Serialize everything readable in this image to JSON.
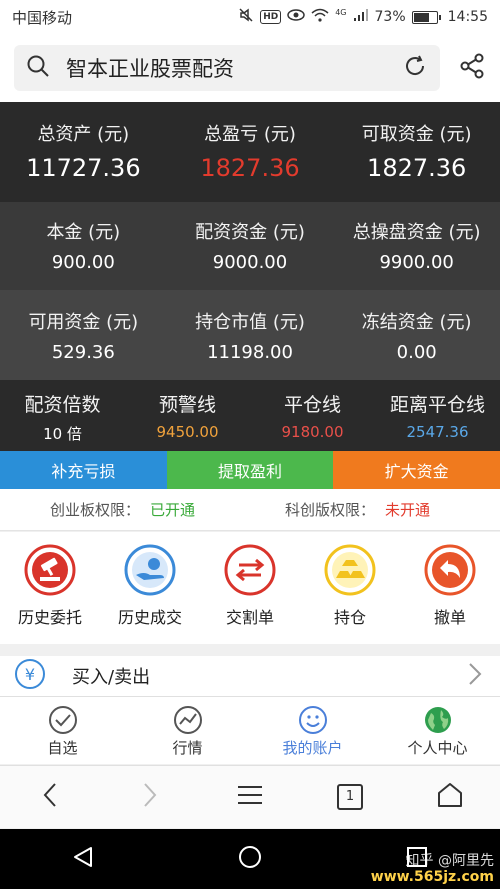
{
  "status_bar": {
    "carrier": "中国移动",
    "hd": "HD",
    "network": "4G",
    "battery": "73%",
    "battery_level": 0.73,
    "time": "14:55"
  },
  "search": {
    "title": "智本正业股票配资",
    "icons": [
      "search-icon",
      "refresh-icon",
      "share-icon"
    ]
  },
  "account": {
    "row1": [
      {
        "label": "总资产 (元)",
        "value": "11727.36",
        "color": "#ffffff"
      },
      {
        "label": "总盈亏 (元)",
        "value": "1827.36",
        "color": "#e23b2d"
      },
      {
        "label": "可取资金 (元)",
        "value": "1827.36",
        "color": "#ffffff"
      }
    ],
    "row2": [
      {
        "label": "本金 (元)",
        "value": "900.00"
      },
      {
        "label": "配资资金 (元)",
        "value": "9000.00"
      },
      {
        "label": "总操盘资金 (元)",
        "value": "9900.00"
      }
    ],
    "row3": [
      {
        "label": "可用资金 (元)",
        "value": "529.36"
      },
      {
        "label": "持仓市值 (元)",
        "value": "11198.00"
      },
      {
        "label": "冻结资金 (元)",
        "value": "0.00"
      }
    ],
    "row4": [
      {
        "label": "配资倍数",
        "value": "10 倍",
        "color": "#ffffff"
      },
      {
        "label": "预警线",
        "value": "9450.00",
        "color": "#f0a23c"
      },
      {
        "label": "平仓线",
        "value": "9180.00",
        "color": "#e8504a"
      },
      {
        "label": "距离平仓线",
        "value": "2547.36",
        "color": "#5aa8e8"
      }
    ]
  },
  "actions": [
    {
      "label": "补充亏损",
      "color": "#2a8fd8"
    },
    {
      "label": "提取盈利",
      "color": "#4cb84c"
    },
    {
      "label": "扩大资金",
      "color": "#f07a1e"
    }
  ],
  "permissions": {
    "gem_label": "创业板权限：",
    "gem_status": "已开通",
    "star_label": "科创版权限：",
    "star_status": "未开通"
  },
  "quick_menu": [
    {
      "label": "历史委托",
      "icon": "gavel-icon",
      "color": "#d9342b"
    },
    {
      "label": "历史成交",
      "icon": "hand-coin-icon",
      "color": "#3b8ad8"
    },
    {
      "label": "交割单",
      "icon": "exchange-arrows-icon",
      "color": "#d9342b"
    },
    {
      "label": "持仓",
      "icon": "gold-bars-icon",
      "color": "#f2c21e"
    },
    {
      "label": "撤单",
      "icon": "undo-arrow-icon",
      "color": "#e8552a"
    }
  ],
  "buy_sell": {
    "label": "买入/卖出",
    "icon_text": "￥"
  },
  "tabs": [
    {
      "label": "自选",
      "icon": "check-circle-icon",
      "active": false
    },
    {
      "label": "行情",
      "icon": "trend-chart-icon",
      "active": false
    },
    {
      "label": "我的账户",
      "icon": "smiley-icon",
      "active": true
    },
    {
      "label": "个人中心",
      "icon": "globe-icon",
      "active": false
    }
  ],
  "browser_bar": {
    "tab_count": "1"
  },
  "watermark": {
    "line1": "知乎 @阿里先",
    "line2": "www.565jz.com"
  }
}
